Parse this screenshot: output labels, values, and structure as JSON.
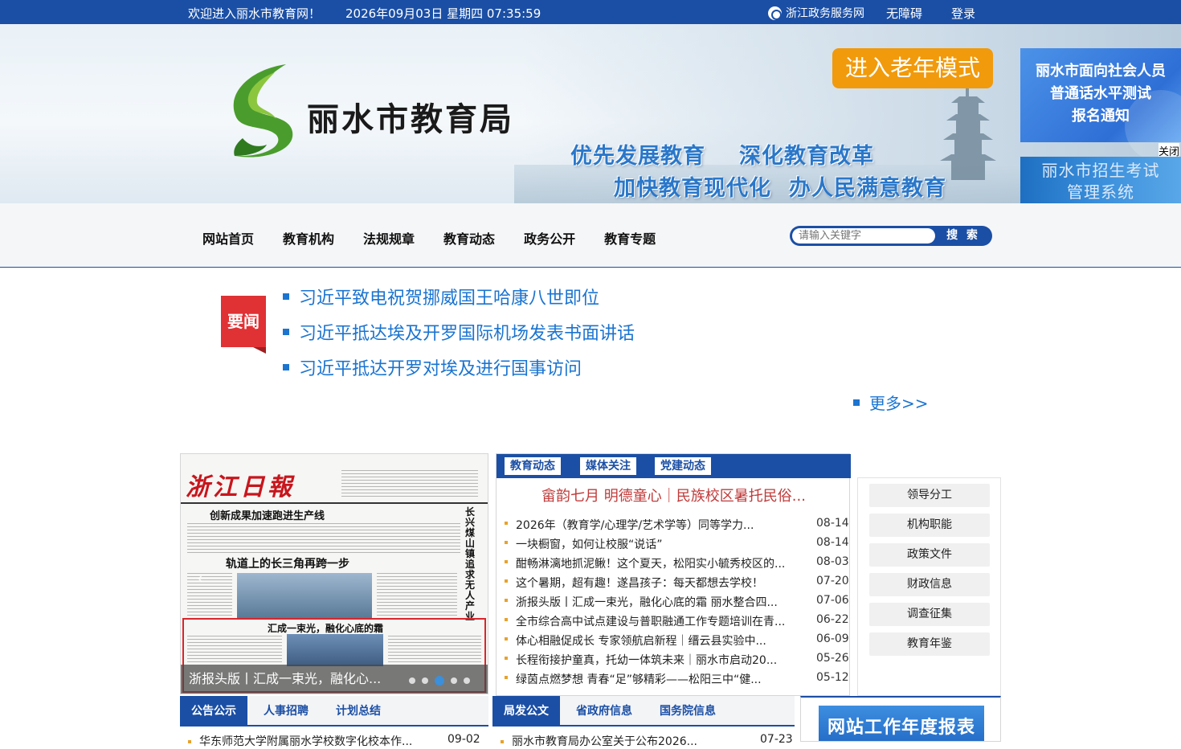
{
  "topbar": {
    "welcome": "欢迎进入丽水市教育网！",
    "datetime": "2026年09月03日 星期四 07:35:59",
    "gov_link": "浙江政务服务网",
    "accessibility": "无障碍",
    "login": "登录"
  },
  "banner": {
    "logo_text": "丽水市教育局",
    "slogans": [
      "优先发展教育",
      "深化教育改革",
      "加快教育现代化",
      "办人民满意教育"
    ],
    "elder_mode": "进入老年模式"
  },
  "ads": {
    "ad1_lines": [
      "丽水市面向社会人员",
      "普通话水平测试",
      "报名通知"
    ],
    "ad2_lines": [
      "丽水市招生考试",
      "管理系统"
    ],
    "close": "关闭"
  },
  "nav": {
    "items": [
      "网站首页",
      "教育机构",
      "法规规章",
      "教育动态",
      "政务公开",
      "教育专题"
    ],
    "search_placeholder": "请输入关键字",
    "search_button": "搜 索"
  },
  "headlines": {
    "badge": "要闻",
    "items": [
      "习近平致电祝贺挪威国王哈康八世即位",
      "习近平抵达埃及开罗国际机场发表书面讲话",
      "习近平抵达开罗对埃及进行国事访问"
    ],
    "more": "更多>>"
  },
  "slider": {
    "masthead": "浙江日報",
    "headline1": "创新成果加速跑进生产线",
    "headline2": "轨道上的长三角再跨一步",
    "headline3": "汇成一束光，融化心底的霜",
    "vertical_title": "长兴煤山镇追求无人产业",
    "caption": "浙报头版丨汇成一束光，融化心...",
    "arrow_left": "‹",
    "arrow_right": "›",
    "active_index": 2
  },
  "news_panel": {
    "tabs": [
      "教育动态",
      "媒体关注",
      "党建动态"
    ],
    "featured": "畲韵七月 明德童心｜民族校区暑托民俗...",
    "items": [
      {
        "title": "2026年（教育学/心理学/艺术学等）同等学力...",
        "date": "08-14"
      },
      {
        "title": "一块橱窗，如何让校服“说话”",
        "date": "08-14"
      },
      {
        "title": "酣畅淋漓地抓泥鳅！这个夏天，松阳实小毓秀校区的...",
        "date": "08-03"
      },
      {
        "title": "这个暑期，超有趣！遂昌孩子：每天都想去学校！",
        "date": "07-20"
      },
      {
        "title": "浙报头版丨汇成一束光，融化心底的霜 丽水整合四...",
        "date": "07-06"
      },
      {
        "title": "全市综合高中试点建设与普职融通工作专题培训在青...",
        "date": "06-22"
      },
      {
        "title": "体心相融促成长 专家领航启新程｜缙云县实验中...",
        "date": "06-09"
      },
      {
        "title": "长程衔接护童真，托幼一体筑未来｜丽水市启动20...",
        "date": "05-26"
      },
      {
        "title": "绿茵点燃梦想 青春“足”够精彩——松阳三中“健...",
        "date": "05-12"
      }
    ]
  },
  "quick_links": [
    "领导分工",
    "机构职能",
    "政策文件",
    "财政信息",
    "调查征集",
    "教育年鉴"
  ],
  "bottom_left": {
    "tabs": [
      "公告公示",
      "人事招聘",
      "计划总结"
    ],
    "first_item": {
      "title": "华东师范大学附属丽水学校数字化校本作...",
      "date": "09-02"
    }
  },
  "bottom_mid": {
    "tabs": [
      "局发公文",
      "省政府信息",
      "国务院信息"
    ],
    "first_item": {
      "title": "丽水市教育局办公室关于公布2026...",
      "date": "07-23"
    }
  },
  "report": {
    "label": "网站工作年度报表"
  },
  "colors": {
    "primary": "#1b4fa5",
    "accent_orange": "#f19a0c",
    "headline_blue": "#1b74d0",
    "badge_red": "#e03134"
  }
}
